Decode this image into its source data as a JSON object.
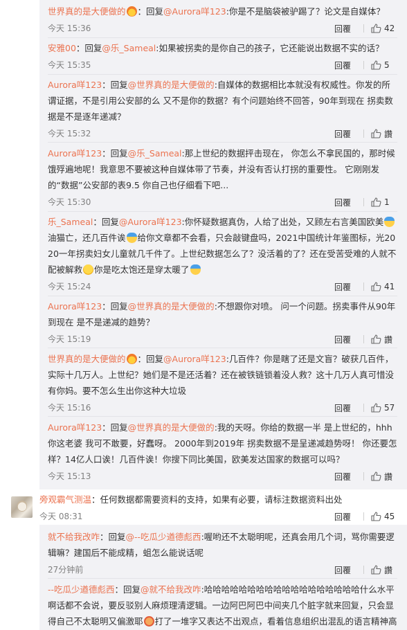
{
  "comments": [
    {
      "user": "世界真的是大便做的",
      "emoji": "fire",
      "reply_word": "：回复",
      "mention": "@Aurora咩123",
      "text": ":你是不是脑袋被驴踢了？论文是自媒体？",
      "time": "今天 15:36",
      "reply_label": "回覆",
      "likes": "42"
    },
    {
      "user": "安雅00",
      "reply_word": "：回复",
      "mention": "@乐_Sameal",
      "text": ":如果被拐卖的是你自己的孩子，它还能说出数据不实的话？",
      "time": "今天 15:35",
      "reply_label": "回覆",
      "likes": "5"
    },
    {
      "user": "Aurora咩123",
      "reply_word": "：回复",
      "mention": "@世界真的是大便做的",
      "text": ":自媒体的数据相比本就没有权威性。你发的所谓证据，不是引用公安部的么 又不是你的数据？有个问题始终不回答，90年到现在 拐卖数据是不是逐年递减？",
      "time": "今天 15:32",
      "reply_label": "回覆",
      "likes": "讚"
    },
    {
      "user": "Aurora咩123",
      "reply_word": "：回复",
      "mention": "@乐_Sameal",
      "text": ":那上世纪的数据抨击现在， 你怎么不拿民国的，那时候饿殍遍地呢！我意思不要被这种自媒体带了节奏，并没有否认打拐的重要性。 它刚刚发的“数据”公安部的表9.5 你自己也仔细看下吧...",
      "time": "今天 15:30",
      "reply_label": "回覆",
      "likes": "1"
    },
    {
      "user": "乐_Sameal",
      "reply_word": "：回复",
      "mention": "@Aurora咩123",
      "text_a": ":你怀疑数据真伪，人给了出处，又顾左右言美国欧美",
      "text_b": "油猫亡，还几百件诶",
      "text_c": "给你文章都不会看，只会敲键盘吗，2021中国统计年鉴图标，光2020一年拐卖妇女儿童就几千件了。上世纪数据怎么了？没活着的了？还在受苦受难的人就不配被解救",
      "text_d": "你是吃太饱还是穿太暖了",
      "time": "今天 15:24",
      "reply_label": "回覆",
      "likes": "41"
    },
    {
      "user": "Aurora咩123",
      "reply_word": "：回复",
      "mention": "@世界真的是大便做的",
      "text": ":不想跟你对喷。 问一个问题。拐卖事件从90年到现在 是不是递减的趋势？",
      "time": "今天 15:19",
      "reply_label": "回覆",
      "likes": "讚"
    },
    {
      "user": "世界真的是大便做的",
      "emoji": "fire",
      "reply_word": "：回复",
      "mention": "@Aurora咩123",
      "text": ":几百件？你是瞎了还是文盲？破获几百件，实际十几万人。上世纪？她们是不是还活着？还在被铁链锁着没人救？这十几万人真可惜没有你妈。要不怎么生出你这种大垃圾",
      "time": "今天 15:16",
      "reply_label": "回覆",
      "likes": "57"
    },
    {
      "user": "Aurora咩123",
      "reply_word": "：回复",
      "mention": "@世界真的是大便做的",
      "text": ":我的天呀。你给的数据一半 是上世纪的，hhh 你这老婆 我可不敢要，好蠢呀。 2000年到2019年 拐卖数据不是呈递减趋势呀！ 你还要怎样？14亿人口诶！几百件诶！你搜下同比美国，欧美发达国家的数据可以吗？",
      "time": "今天 15:13",
      "reply_label": "回覆",
      "likes": "讚"
    }
  ],
  "main_comment": {
    "user": "旁观霸气测温",
    "text": "：任何数据都需要资料的支持，如果有必要，请标注数据资料出处",
    "time": "今天 08:31",
    "reply_label": "回覆",
    "likes": "45"
  },
  "sub_comments": [
    {
      "user": "就不给我改咋",
      "reply_word": "：回复",
      "mention": "@--吃瓜少遒德彪西",
      "text": ":喔哟还不太聪明呢，还真会用几个词，骂你需要逻辑嘛？建国后不能成精，蛆怎么能说话呢",
      "time": "27分钟前",
      "reply_label": "回覆",
      "likes": "讚"
    },
    {
      "user": "--吃瓜少遒德彪西",
      "reply_word": "：回复",
      "mention": "@就不给我改咋",
      "text_a": ":哈哈哈哈哈哈哈哈哈哈哈哈哈哈哈哈哈哈什么水平啊话都不会说，要反驳别人麻烦理清逻辑。一边阿巴阿巴中间夹几个脏字就来回复，只会显得自己不太聪明又偏激耶",
      "text_b": "打了一堆字又表达不出观点，看着信息组织出混乱的语言精神高"
    }
  ],
  "colors": {
    "accent": "#eb7350",
    "thread_bg": "#f2f2f5",
    "meta": "#808080"
  }
}
